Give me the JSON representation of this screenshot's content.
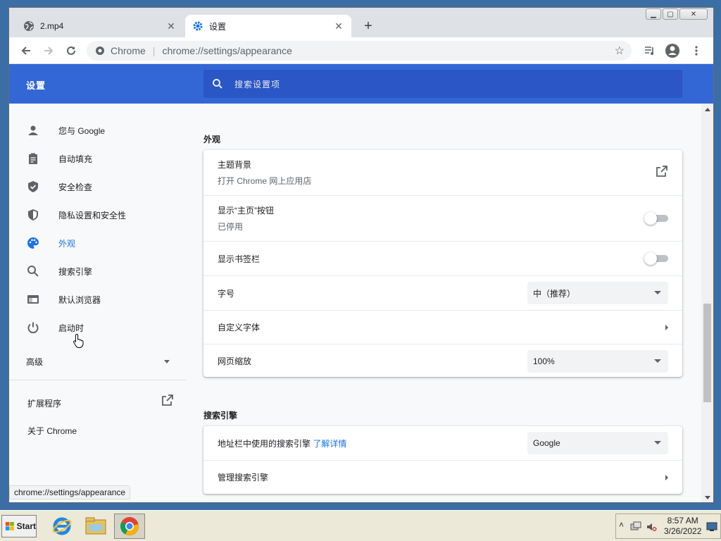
{
  "browser": {
    "tabs": [
      {
        "title": "2.mp4",
        "active": false
      },
      {
        "title": "设置",
        "active": true
      }
    ],
    "new_tab_label": "+",
    "omnibox": {
      "origin": "Chrome",
      "path": "chrome://settings/appearance"
    },
    "status_url": "chrome://settings/appearance"
  },
  "settings": {
    "title": "设置",
    "search_placeholder": "搜索设置项"
  },
  "sidebar": {
    "items": [
      {
        "label": "您与 Google",
        "icon": "person-icon"
      },
      {
        "label": "自动填充",
        "icon": "clipboard-icon"
      },
      {
        "label": "安全检查",
        "icon": "shield-check-icon"
      },
      {
        "label": "隐私设置和安全性",
        "icon": "shield-half-icon"
      },
      {
        "label": "外观",
        "icon": "palette-icon",
        "selected": true
      },
      {
        "label": "搜索引擎",
        "icon": "search-icon"
      },
      {
        "label": "默认浏览器",
        "icon": "browser-icon"
      },
      {
        "label": "启动时",
        "icon": "power-icon"
      }
    ],
    "advanced": "高级",
    "extensions": "扩展程序",
    "about": "关于 Chrome"
  },
  "appearance": {
    "section_title": "外观",
    "theme_label": "主题背景",
    "theme_sub": "打开 Chrome 网上应用店",
    "home_label": "显示“主页”按钮",
    "home_sub": "已停用",
    "bookmarks_label": "显示书签栏",
    "font_size_label": "字号",
    "font_size_value": "中（推荐）",
    "customize_fonts_label": "自定义字体",
    "zoom_label": "网页缩放",
    "zoom_value": "100%"
  },
  "search_engine": {
    "section_title": "搜索引擎",
    "label": "地址栏中使用的搜索引擎",
    "learn_more": "了解详情",
    "value": "Google",
    "manage_label": "管理搜索引擎"
  },
  "taskbar": {
    "start_label": "Start",
    "time": "8:57 AM",
    "date": "3/26/2022"
  },
  "colors": {
    "header_blue": "#3367d6",
    "accent": "#1a73e8"
  }
}
